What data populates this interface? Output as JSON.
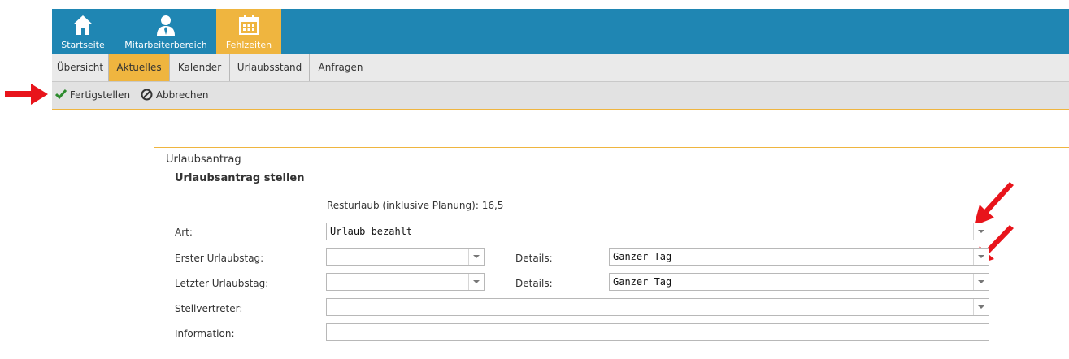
{
  "topnav": {
    "items": [
      {
        "label": "Startseite",
        "icon": "home-icon"
      },
      {
        "label": "Mitarbeiterbereich",
        "icon": "person-icon"
      },
      {
        "label": "Fehlzeiten",
        "icon": "calendar-icon",
        "active": true
      }
    ]
  },
  "tabs": [
    "Übersicht",
    "Aktuelles",
    "Kalender",
    "Urlaubsstand",
    "Anfragen"
  ],
  "toolbar": {
    "finish_label": "Fertigstellen",
    "cancel_label": "Abbrechen"
  },
  "form": {
    "title": "Urlaubsantrag",
    "subtitle": "Urlaubsantrag stellen",
    "resturlaub": "Resturlaub (inklusive Planung): 16,5",
    "art_label": "Art:",
    "art_value": "Urlaub bezahlt",
    "first_day_label": "Erster Urlaubstag:",
    "first_day_value": "",
    "first_details_label": "Details:",
    "first_details_value": "Ganzer Tag",
    "last_day_label": "Letzter Urlaubstag:",
    "last_day_value": "",
    "last_details_label": "Details:",
    "last_details_value": "Ganzer Tag",
    "deputy_label": "Stellvertreter:",
    "deputy_value": "",
    "info_label": "Information:",
    "info_value": ""
  },
  "colors": {
    "topbar": "#1f86b3",
    "accent": "#efb53f",
    "arrow": "#e8141b",
    "check": "#2e8b2e"
  }
}
